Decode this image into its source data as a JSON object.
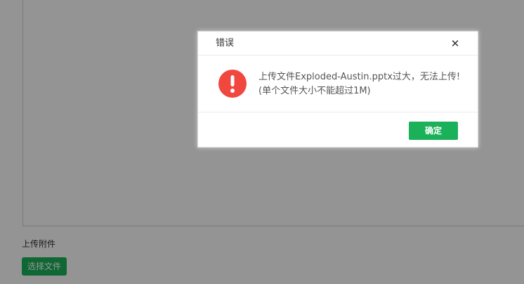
{
  "page": {
    "upload_label": "上传附件",
    "choose_file_label": "选择文件"
  },
  "dialog": {
    "title": "错误",
    "close_glyph": "✕",
    "message": "上传文件Exploded-Austin.pptx过大，无法上传!(单个文件大小不能超过1M)",
    "confirm_label": "确定",
    "icon": "exclamation-circle-icon"
  },
  "colors": {
    "accent_green": "#1bb15a",
    "error_red": "#f0473f",
    "overlay": "rgba(0,0,0,0.42)"
  }
}
